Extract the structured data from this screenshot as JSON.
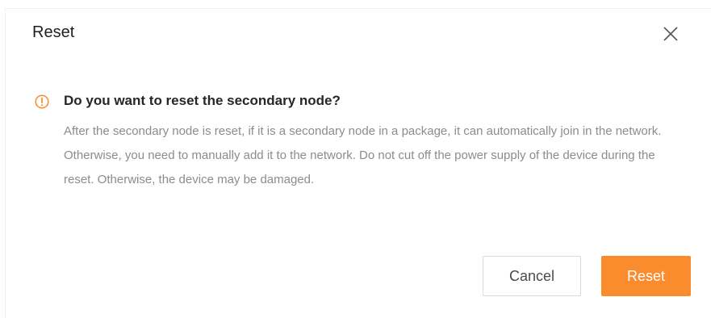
{
  "dialog": {
    "title": "Reset",
    "question": "Do you want to reset the secondary node?",
    "message": "After the secondary node is reset, if it is a secondary node in a package, it can automatically join in the network. Otherwise, you need to manually add it to the network. Do not cut off the power supply of the device during the reset. Otherwise, the device may be damaged.",
    "cancel_label": "Cancel",
    "confirm_label": "Reset",
    "icons": {
      "close": "close-icon",
      "warning": "warning-icon"
    },
    "colors": {
      "accent": "#fa8c2d",
      "warning": "#fa8c2d",
      "title": "#1f1f1f",
      "question": "#262626",
      "message": "#8c8c8c"
    }
  }
}
